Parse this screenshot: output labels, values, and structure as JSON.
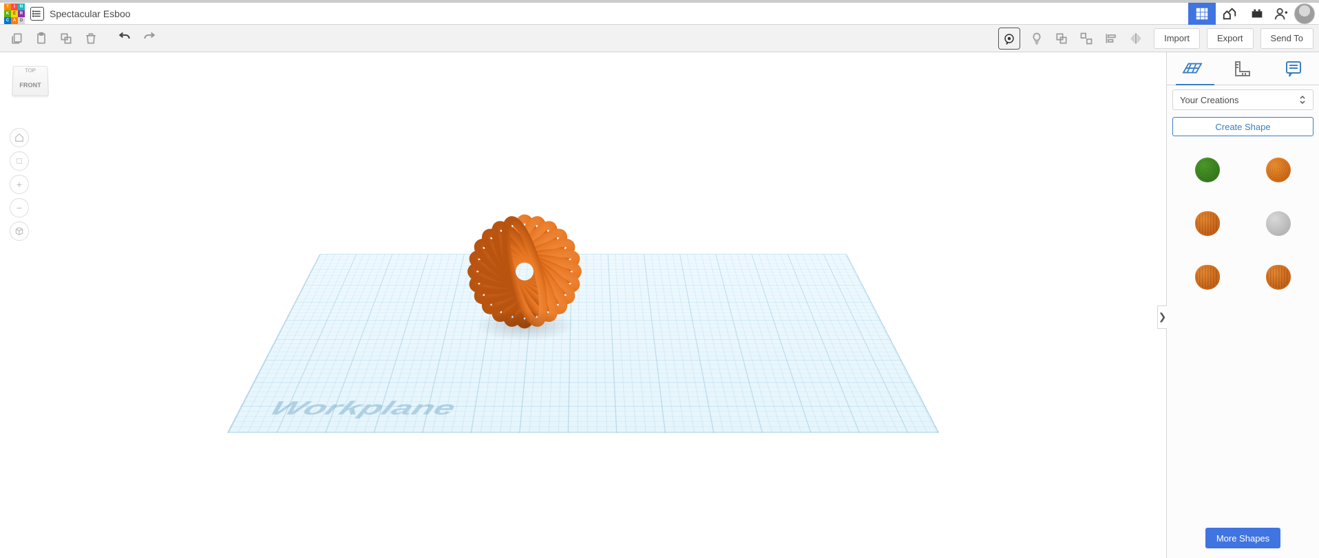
{
  "app": {
    "logo_letters": [
      "T",
      "I",
      "N",
      "K",
      "E",
      "R",
      "C",
      "A",
      "D"
    ],
    "design_name": "Spectacular Esboo"
  },
  "topbar_modes": {
    "grid_active": true
  },
  "toolbar": {
    "import_label": "Import",
    "export_label": "Export",
    "sendto_label": "Send To"
  },
  "viewcube": {
    "top": "TOP",
    "front": "FRONT"
  },
  "workplane": {
    "label": "Workplane"
  },
  "right_panel": {
    "dropdown_selected": "Your Creations",
    "create_shape_label": "Create Shape",
    "more_shapes_label": "More Shapes",
    "shapes": [
      {
        "id": "shape-1",
        "style": "thumb-green thumb-wavy"
      },
      {
        "id": "shape-2",
        "style": "thumb-orange thumb-wavy"
      },
      {
        "id": "shape-3",
        "style": "thumb-gray thumb-pumpkin"
      },
      {
        "id": "shape-4",
        "style": "thumb-gray"
      },
      {
        "id": "shape-5",
        "style": "thumb-pumpkin"
      },
      {
        "id": "shape-6",
        "style": "thumb-pumpkin"
      }
    ]
  },
  "colors": {
    "pumpkin": "#e87722",
    "pumpkin_dark": "#b85410",
    "grid": "#bfe3f2"
  }
}
